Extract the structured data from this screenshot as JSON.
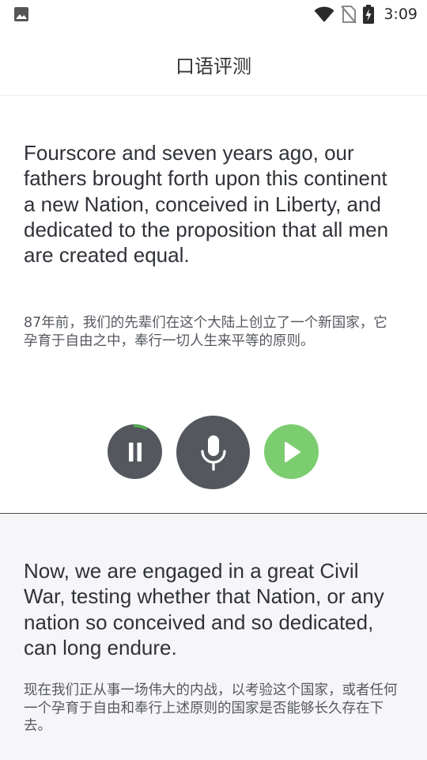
{
  "status_bar": {
    "time": "3:09",
    "icons": [
      "gallery-icon",
      "wifi-icon",
      "no-sim-icon",
      "battery-charging-icon"
    ]
  },
  "header": {
    "title": "口语评测"
  },
  "sentences": [
    {
      "english": "Fourscore and seven years ago, our fathers brought forth upon this continent a new Nation, conceived in Liberty, and dedicated to the proposition that all men are created equal.",
      "chinese": "87年前，我们的先辈们在这个大陆上创立了一个新国家，它孕育于自由之中，奉行一切人生来平等的原则。"
    },
    {
      "english": "Now, we are engaged in a great Civil War, testing whether that Nation, or any nation so conceived and so dedicated, can long endure.",
      "chinese": "现在我们正从事一场伟大的内战，以考验这个国家，或者任何一个孕育于自由和奉行上述原则的国家是否能够长久存在下去。"
    }
  ],
  "controls": {
    "icons": [
      "pause-icon",
      "microphone-icon",
      "play-icon"
    ],
    "playback_progress": 0.07,
    "colors": {
      "dark_button": "#55575f",
      "play_button": "#7ccd70",
      "progress": "#4caf50"
    }
  }
}
